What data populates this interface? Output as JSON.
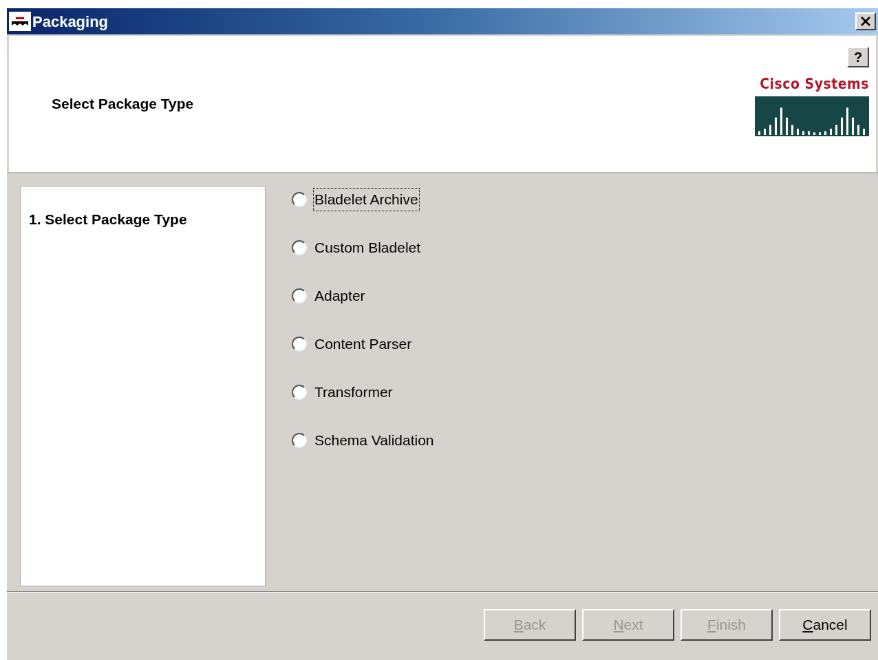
{
  "window": {
    "title": "Packaging"
  },
  "header": {
    "title": "Select Package Type",
    "help": "?",
    "logo_text": "Cisco Systems"
  },
  "steps": [
    {
      "label": "1. Select Package Type",
      "selected": true
    }
  ],
  "options": [
    {
      "label": "Bladelet Archive",
      "selected": false,
      "focused": true
    },
    {
      "label": "Custom Bladelet",
      "selected": false,
      "focused": false
    },
    {
      "label": "Adapter",
      "selected": false,
      "focused": false
    },
    {
      "label": "Content Parser",
      "selected": false,
      "focused": false
    },
    {
      "label": "Transformer",
      "selected": false,
      "focused": false
    },
    {
      "label": "Schema Validation",
      "selected": false,
      "focused": false
    }
  ],
  "buttons": [
    {
      "label": "Back",
      "disabled": true
    },
    {
      "label": "Next",
      "disabled": true
    },
    {
      "label": "Finish",
      "disabled": true
    },
    {
      "label": "Cancel",
      "disabled": false
    }
  ]
}
